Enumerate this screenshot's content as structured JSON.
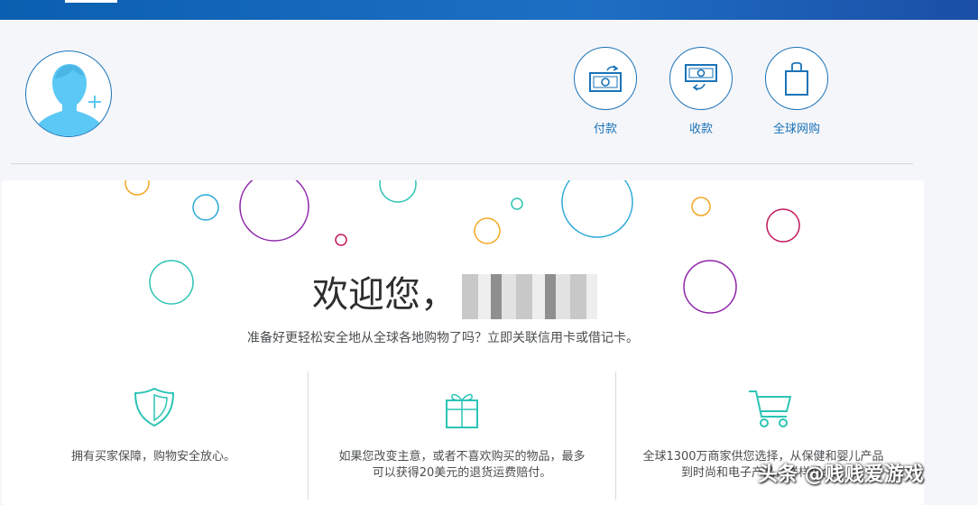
{
  "colors": {
    "brand": "#1a73b8",
    "topbar": "#0b5fb0",
    "avatar": "#5bc8f5",
    "feature_icon": "#2cc4b5"
  },
  "header": {
    "active_tab_indicator": "tab-underline"
  },
  "profile": {
    "avatar_icon": "user-add-icon"
  },
  "quick_actions": [
    {
      "label": "付款",
      "icon": "send-money-icon"
    },
    {
      "label": "收款",
      "icon": "receive-money-icon"
    },
    {
      "label": "全球网购",
      "icon": "shopping-bag-icon"
    }
  ],
  "welcome": {
    "title": "欢迎您，",
    "subtitle": "准备好更轻松安全地从全球各地购物了吗？立即关联信用卡或借记卡。"
  },
  "features": [
    {
      "icon": "shield-icon",
      "text": "拥有买家保障，购物安全放心。"
    },
    {
      "icon": "gift-icon",
      "text_line1": "如果您改变主意，或者不喜欢购买的物品，最多",
      "text_line2": "可以获得20美元的退货运费赔付。"
    },
    {
      "icon": "cart-icon",
      "text_line1": "全球1300万商家供您选择，从保健和婴儿产品",
      "text_line2": "到时尚和电子产品，样样俱全。"
    }
  ],
  "watermark": "头条 @贱贱爱游戏"
}
